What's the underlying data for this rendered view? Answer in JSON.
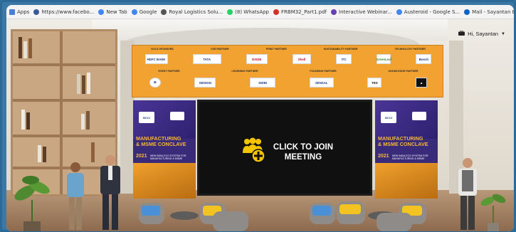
{
  "bookmarks": [
    {
      "label": "Apps",
      "icon": "apps-grid-icon",
      "color": "#4a7fd8"
    },
    {
      "label": "https://www.facebo...",
      "icon": "facebook-icon",
      "color": "#3b5998"
    },
    {
      "label": "New Tab",
      "icon": "google-g-icon",
      "color": "#4285f4"
    },
    {
      "label": "Google",
      "icon": "google-g-icon",
      "color": "#4285f4"
    },
    {
      "label": "Royal Logistics Solu...",
      "icon": "globe-icon",
      "color": "#555555"
    },
    {
      "label": "(8) WhatsApp",
      "icon": "whatsapp-icon",
      "color": "#25d366"
    },
    {
      "label": "FRBM32_Part1.pdf",
      "icon": "pdf-icon",
      "color": "#d93025"
    },
    {
      "label": "Interactive Webinar...",
      "icon": "webinar-icon",
      "color": "#6a3fb5"
    },
    {
      "label": "Austeroid - Google S...",
      "icon": "google-g-icon",
      "color": "#4285f4"
    },
    {
      "label": "Mail - Sayantan Be...",
      "icon": "outlook-mail-icon",
      "color": "#0a64c8"
    }
  ],
  "user": {
    "greeting": "Hi, Sayantan",
    "icon": "briefcase-icon"
  },
  "board": {
    "row1_headers": [
      "GOLD SPONSORS",
      "CSR PARTNER",
      "PRINT PARTNER",
      "SUSTAINABILITY PARTNER",
      "TECHNOLOGY PARTNER"
    ],
    "row1_logos": [
      "HDFC BANK",
      "TATA",
      "EXIDE",
      "Shell",
      "ITC",
      "GreenLeaf",
      "Bosch"
    ],
    "row2_headers": [
      "EVENT PARTNER",
      "LEARNING PARTNER",
      "FOUNDING PARTNER",
      "KNOWLEDGE PARTNER"
    ],
    "row2_logos": [
      "⊕",
      "DESIGN",
      "SIDBI",
      "ZENSAL",
      "TES",
      "▲"
    ]
  },
  "poster": {
    "badge": "BCCI",
    "title_line1": "MANUFACTURING",
    "title_line2": "& MSME CONCLAVE",
    "year": "2021",
    "subtitle": "NEW INDIA ECO SYSTEM FOR MANUFACTURING & MSME"
  },
  "cta": {
    "label": "CLICK TO JOIN MEETING",
    "icon": "join-group-icon",
    "accent": "#f5c400"
  }
}
